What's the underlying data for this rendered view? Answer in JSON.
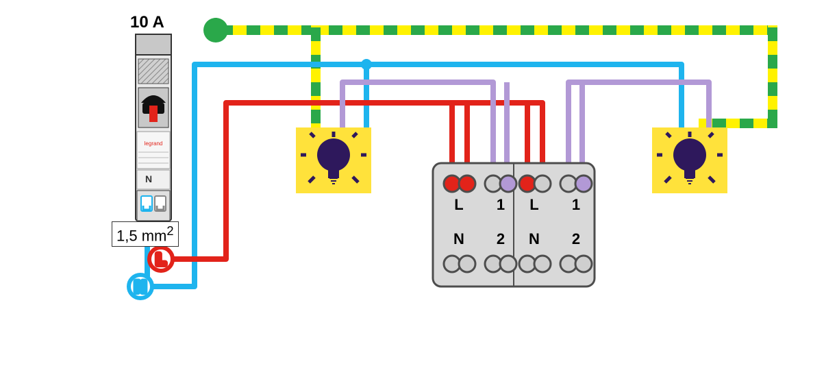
{
  "breaker": {
    "rating": "10 A",
    "brand": "legrand",
    "neutral_label": "N",
    "cable_section": "1,5 mm",
    "cable_section_exp": "2"
  },
  "nodes": {
    "L": "L",
    "N": "N"
  },
  "switch_module": {
    "left": {
      "L": "L",
      "one": "1",
      "N": "N",
      "two": "2"
    },
    "right": {
      "L": "L",
      "one": "1",
      "N": "N",
      "two": "2"
    }
  },
  "colors": {
    "earth_green": "#2aa84a",
    "earth_yellow": "#fff200",
    "neutral": "#1eb4ee",
    "live": "#e2231a",
    "load": "#b299d6",
    "bulb_bg": "#ffe23b",
    "bulb_dark": "#2e185c",
    "module_fill": "#d9d9d9",
    "module_stroke": "#4d4d4d",
    "terminal_fill": "#cfcfcf"
  }
}
